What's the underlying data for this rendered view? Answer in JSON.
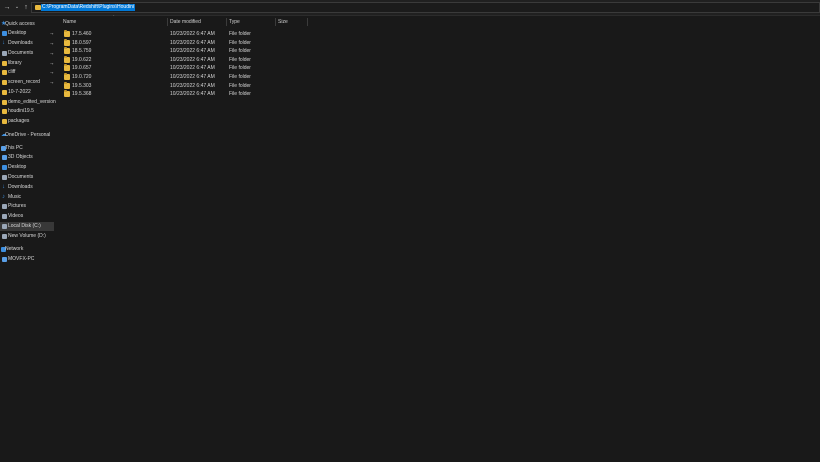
{
  "address": {
    "path": "C:\\ProgramData\\Redshift\\Plugins\\Houdini"
  },
  "nav": {
    "items": [
      {
        "label": "Quick access",
        "icon": "star-icon",
        "color": "#3d8fe0",
        "pinned": false
      },
      {
        "label": "Desktop",
        "icon": "desktop-icon",
        "color": "#3d8fe0",
        "pinned": true
      },
      {
        "label": "Downloads",
        "icon": "download-icon",
        "color": "#3d8fe0",
        "pinned": true
      },
      {
        "label": "Documents",
        "icon": "document-icon",
        "color": "#9aa7b8",
        "pinned": true
      },
      {
        "label": "library",
        "icon": "folder-icon",
        "color": "#e8b93e",
        "pinned": true
      },
      {
        "label": "cliff",
        "icon": "folder-icon",
        "color": "#e8b93e",
        "pinned": true
      },
      {
        "label": "screen_record",
        "icon": "folder-icon",
        "color": "#e8b93e",
        "pinned": true
      },
      {
        "label": "10-7-2022",
        "icon": "folder-icon",
        "color": "#e8b93e",
        "pinned": false
      },
      {
        "label": "demo_edited_version",
        "icon": "folder-icon",
        "color": "#e8b93e",
        "pinned": false
      },
      {
        "label": "houdini19.5",
        "icon": "folder-icon",
        "color": "#e8b93e",
        "pinned": false
      },
      {
        "label": "packages",
        "icon": "folder-icon",
        "color": "#e8b93e",
        "pinned": false
      },
      {
        "label": "OneDrive - Personal",
        "icon": "cloud-icon",
        "color": "#3d8fe0",
        "pinned": false
      },
      {
        "label": "This PC",
        "icon": "computer-icon",
        "color": "#5aa0e8",
        "pinned": false
      },
      {
        "label": "3D Objects",
        "icon": "cube-icon",
        "color": "#5aa0e8",
        "pinned": false
      },
      {
        "label": "Desktop",
        "icon": "desktop-icon",
        "color": "#3d8fe0",
        "pinned": false
      },
      {
        "label": "Documents",
        "icon": "document-icon",
        "color": "#9aa7b8",
        "pinned": false
      },
      {
        "label": "Downloads",
        "icon": "download-icon",
        "color": "#3d8fe0",
        "pinned": false
      },
      {
        "label": "Music",
        "icon": "music-icon",
        "color": "#3d8fe0",
        "pinned": false
      },
      {
        "label": "Pictures",
        "icon": "picture-icon",
        "color": "#9aa7b8",
        "pinned": false
      },
      {
        "label": "Videos",
        "icon": "video-icon",
        "color": "#9aa7b8",
        "pinned": false
      },
      {
        "label": "Local Disk (C:)",
        "icon": "drive-icon",
        "color": "#9aa7b8",
        "pinned": false,
        "selected": true
      },
      {
        "label": "New Volume (D:)",
        "icon": "drive-icon",
        "color": "#9aa7b8",
        "pinned": false
      },
      {
        "label": "Network",
        "icon": "network-icon",
        "color": "#3d8fe0",
        "pinned": false
      },
      {
        "label": "MOVFX-PC",
        "icon": "computer-icon",
        "color": "#5aa0e8",
        "pinned": false
      }
    ]
  },
  "columns": {
    "name": "Name",
    "date": "Date modified",
    "type": "Type",
    "size": "Size"
  },
  "files": [
    {
      "name": "17.5.460",
      "date": "10/23/2022 6:47 AM",
      "type": "File folder",
      "size": ""
    },
    {
      "name": "18.0.597",
      "date": "10/23/2022 6:47 AM",
      "type": "File folder",
      "size": ""
    },
    {
      "name": "18.5.759",
      "date": "10/23/2022 6:47 AM",
      "type": "File folder",
      "size": ""
    },
    {
      "name": "19.0.622",
      "date": "10/23/2022 6:47 AM",
      "type": "File folder",
      "size": ""
    },
    {
      "name": "19.0.657",
      "date": "10/23/2022 6:47 AM",
      "type": "File folder",
      "size": ""
    },
    {
      "name": "19.0.720",
      "date": "10/23/2022 6:47 AM",
      "type": "File folder",
      "size": ""
    },
    {
      "name": "19.5.303",
      "date": "10/23/2022 6:47 AM",
      "type": "File folder",
      "size": ""
    },
    {
      "name": "19.5.368",
      "date": "10/23/2022 6:47 AM",
      "type": "File folder",
      "size": ""
    }
  ]
}
